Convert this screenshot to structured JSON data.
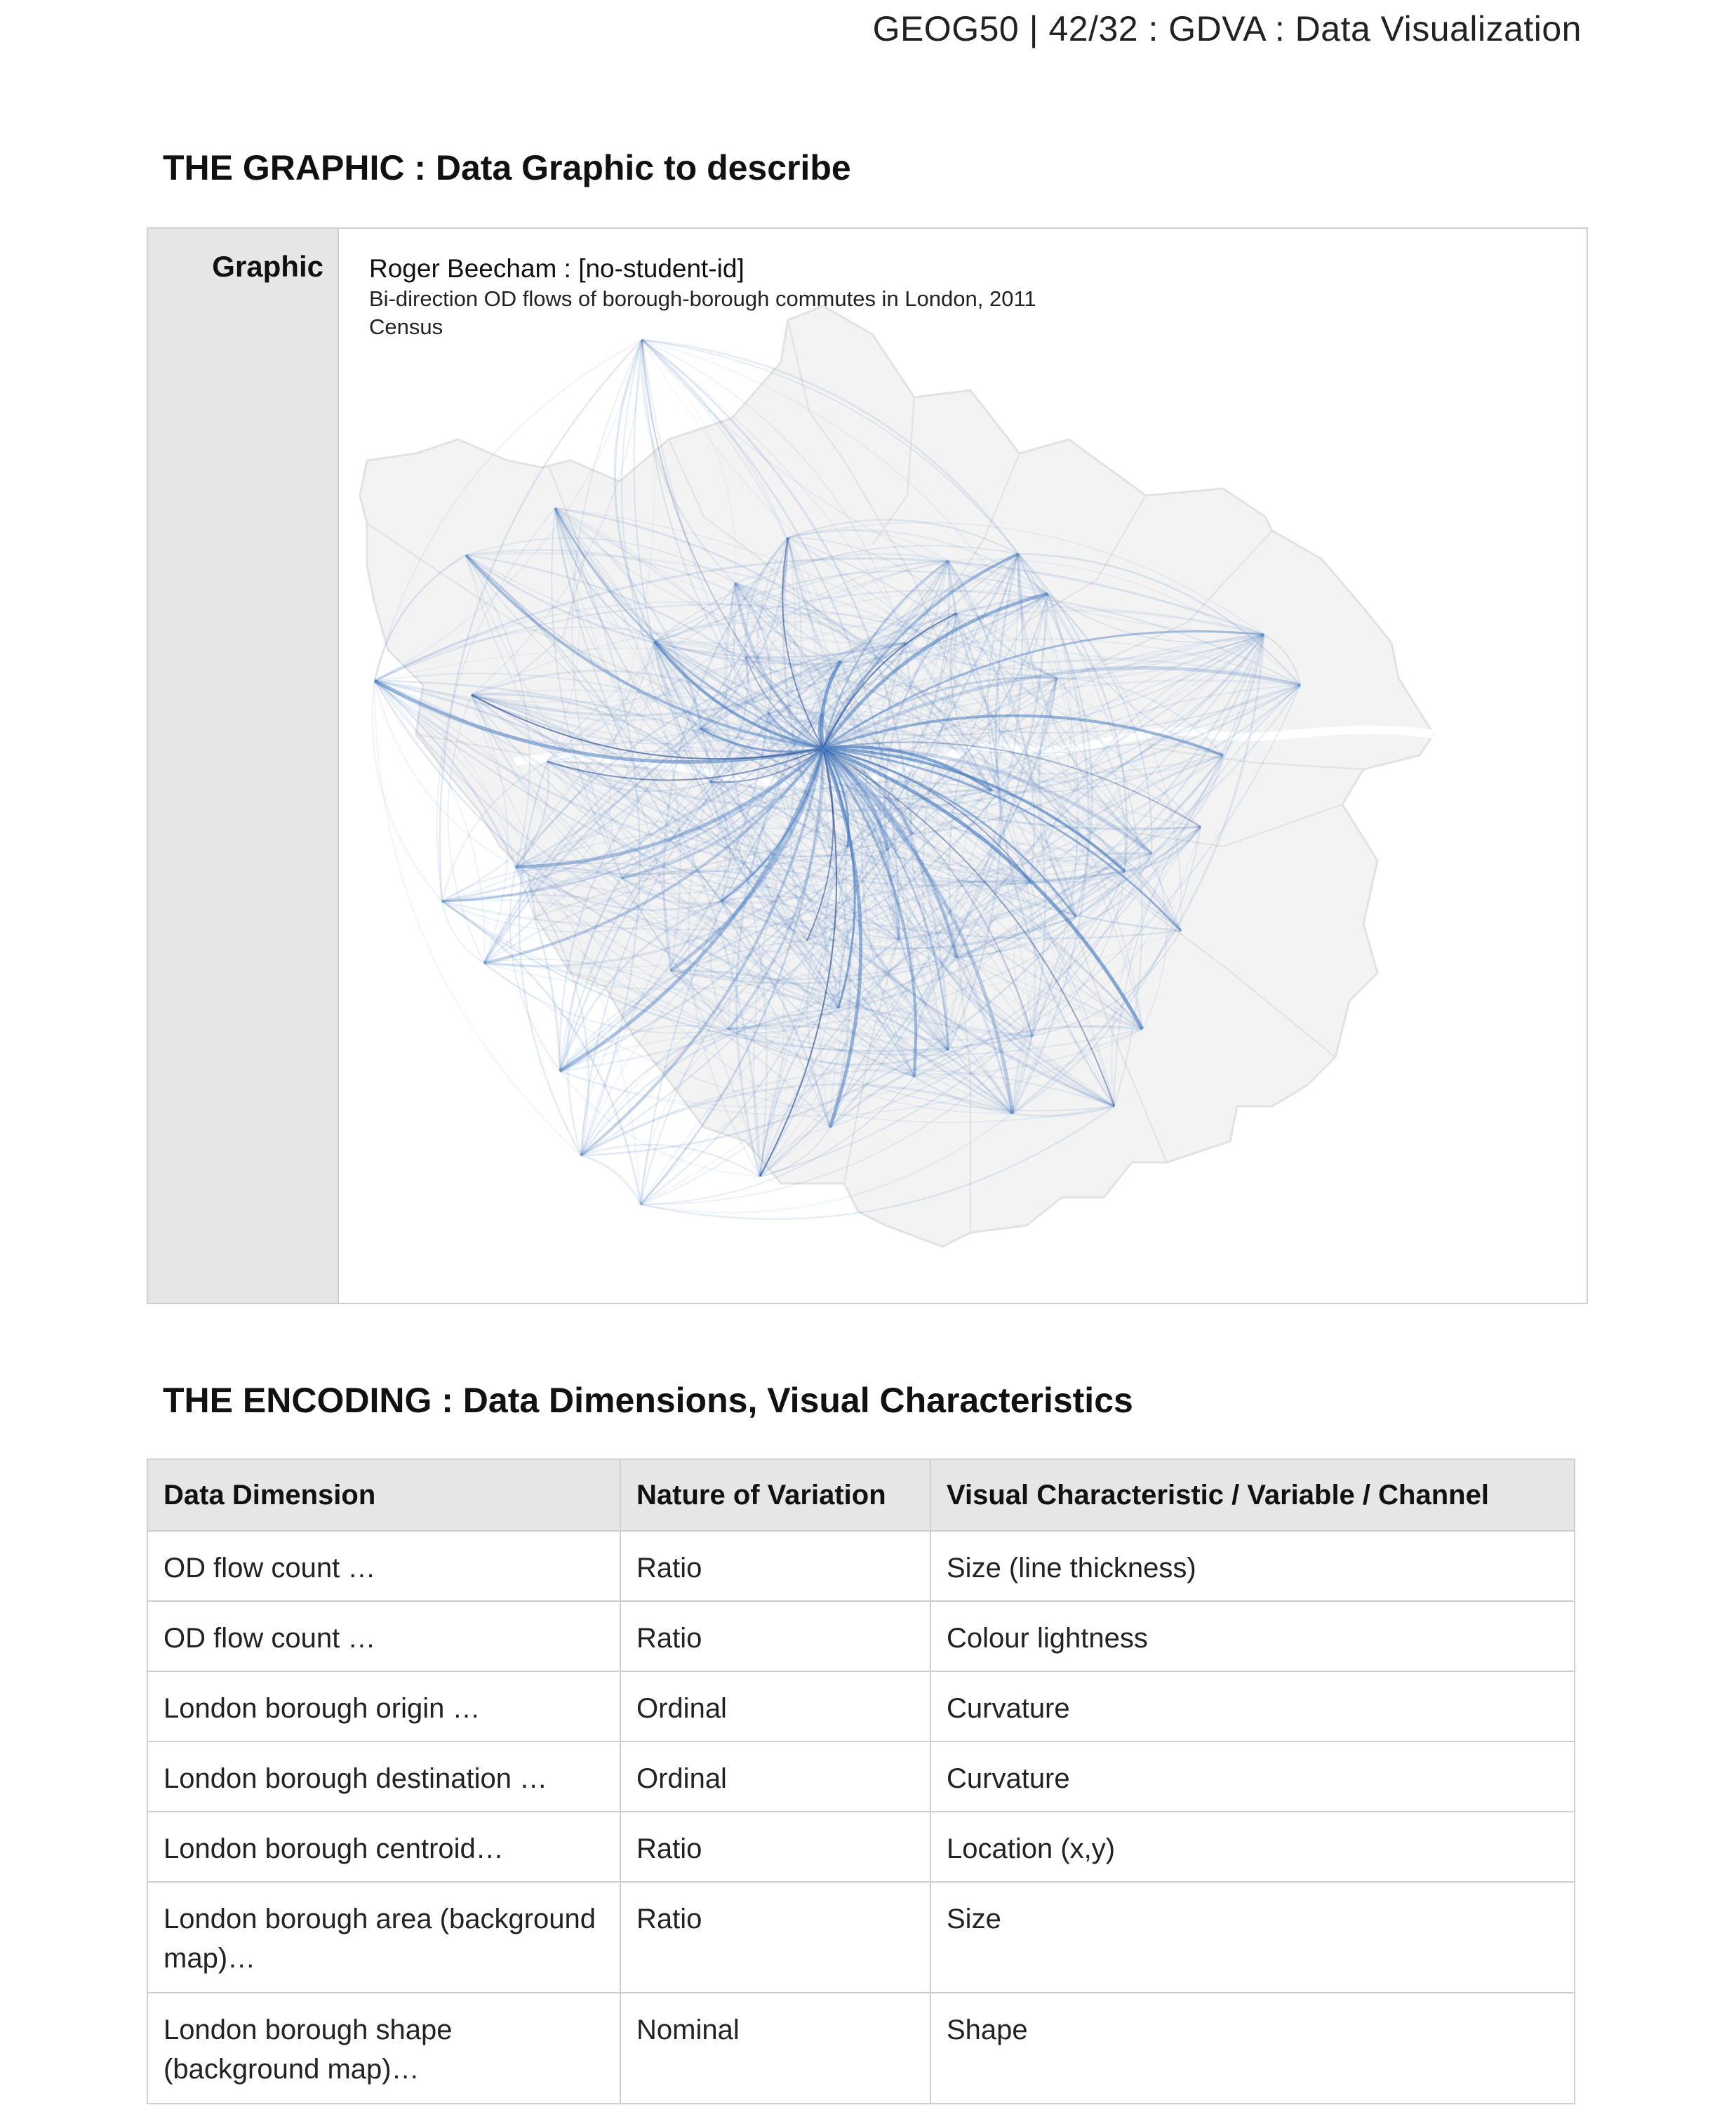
{
  "header": {
    "course": "GEOG50 | 42/32 : GDVA : Data Visualization"
  },
  "graphic_section": {
    "heading": "THE GRAPHIC : Data Graphic to describe",
    "side_label": "Graphic",
    "author": "Roger Beecham : [no-student-id]",
    "subtitle": "Bi-direction OD flows of borough-borough commutes in London, 2011 Census",
    "colors": {
      "flow": "#4a7cc0",
      "flow_strong": "#2a4d8f",
      "borough_fill": "#f2f2f2",
      "borough_stroke": "#e0e0e0"
    }
  },
  "encoding_section": {
    "heading": "THE ENCODING : Data Dimensions, Visual Characteristics",
    "columns": [
      "Data Dimension",
      "Nature of Variation",
      "Visual Characteristic / Variable / Channel"
    ],
    "rows": [
      [
        "OD flow count …",
        "Ratio",
        "Size (line thickness)"
      ],
      [
        "OD flow count …",
        "Ratio",
        "Colour lightness"
      ],
      [
        "London borough origin …",
        "Ordinal",
        "Curvature"
      ],
      [
        "London borough destination …",
        "Ordinal",
        "Curvature"
      ],
      [
        "London borough centroid…",
        "Ratio",
        "Location (x,y)"
      ],
      [
        "London borough area (background map)…",
        "Ratio",
        "Size"
      ],
      [
        "London borough shape (background map)…",
        "Nominal",
        "Shape"
      ]
    ]
  }
}
